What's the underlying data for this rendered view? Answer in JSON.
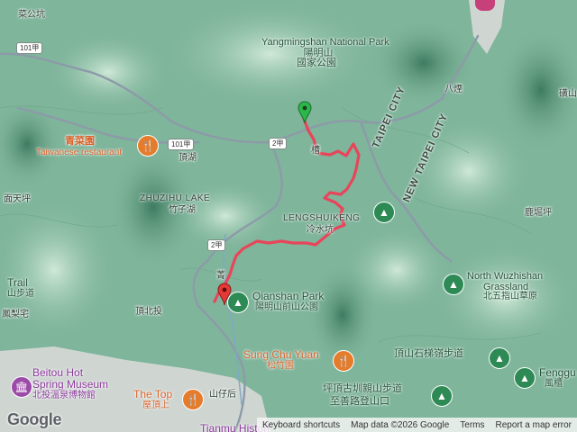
{
  "map": {
    "colors": {
      "forest": "#7fb59b",
      "ridge": "#b9dcc6",
      "valley": "#4f8f72",
      "road": "#8d9aa8",
      "route": "#e8455a",
      "urban": "#cfd6d2"
    },
    "route_name": "",
    "labels": {
      "top_left_village": "菜公坑",
      "park_en": "Yangmingshan National Park",
      "park_zh_1": "陽明山",
      "park_zh_2": "國家公園",
      "restaurant_zh": "青菜園",
      "restaurant_en": "Taiwanese restaurant",
      "dinghu": "頂湖",
      "zhuzihu_en": "ZHUZIHU LAKE",
      "zhuzihu_zh": "竹子湖",
      "miantian": "面天坪",
      "lengshui_en": "LENGSHUIKENG",
      "lengshui_zh": "冷水坑",
      "taipei_city": "TAIPEI CITY",
      "new_taipei_city": "NEW TAIPEI CITY",
      "bayan": "八煙",
      "luku": "鹿堀坪",
      "north_wuzhi_en_1": "North Wuzhishan",
      "north_wuzhi_en_2": "Grassland",
      "north_wuzhi_zh": "北五指山草原",
      "qianshan_en": "Qianshan Park",
      "qianshan_zh": "陽明山前山公園",
      "dingbeitou": "頂北投",
      "fenglixin": "鳳梨宅",
      "trail_left_en": "Trail",
      "trail_left_zh": "山步道",
      "beitou_en_1": "Beitou Hot",
      "beitou_en_2": "Spring Museum",
      "beitou_zh": "北投溫泉博物館",
      "songchu_en": "Sung Chu Yuan",
      "songchu_zh": "松竹園",
      "thetop_en": "The Top",
      "thetop_zh": "屋頂上",
      "shanzaihou": "山仔后",
      "dingshan_trail": "頂山石梯嶺步道",
      "pingding_1": "坪頂古圳親山步道",
      "pingding_2": "至善路登山口",
      "fenggu_en": "Fenggu",
      "fenggu_zh": "風櫃",
      "tianmu": "Tianmu Histori",
      "road_101a_1": "101甲",
      "road_101a_2": "101甲",
      "road_2a_1": "2甲",
      "road_2a_2": "2甲",
      "shan_partial": "磺山",
      "cao": "槽",
      "cai": "菁"
    },
    "icons": {
      "start_pin": "green-flag-pin-icon",
      "end_pin": "red-location-pin-icon",
      "restaurant": "fork-knife-icon",
      "trail": "hiking-icon",
      "museum": "museum-icon",
      "park": "park-icon"
    }
  },
  "attribution": {
    "keyboard": "Keyboard shortcuts",
    "mapdata": "Map data ©2026 Google",
    "terms": "Terms",
    "report": "Report a map error"
  },
  "brand": {
    "logo": "Google"
  }
}
